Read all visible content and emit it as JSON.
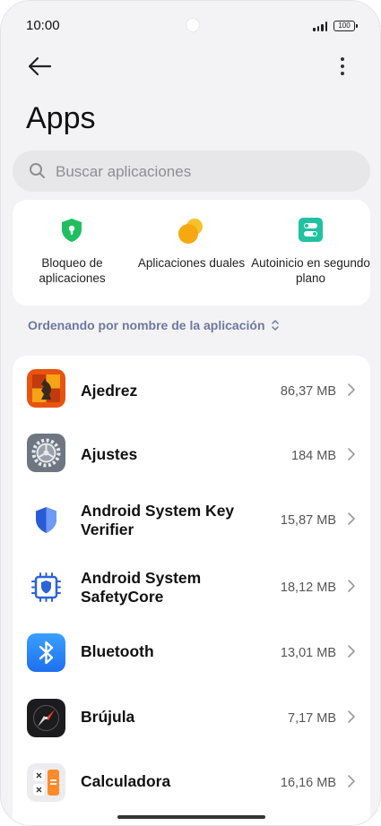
{
  "status_bar": {
    "time": "10:00",
    "battery": "100"
  },
  "header": {
    "title": "Apps"
  },
  "search": {
    "placeholder": "Buscar aplicaciones"
  },
  "features": [
    {
      "label": "Bloqueo de aplicaciones",
      "icon": "shield-lock-icon",
      "color": "#1fbf5f"
    },
    {
      "label": "Aplicaciones duales",
      "icon": "dual-apps-icon",
      "color": "#f5b00f"
    },
    {
      "label": "Autoinicio en segundo plano",
      "icon": "autostart-icon",
      "color": "#20c2a0"
    }
  ],
  "sort": {
    "label": "Ordenando por nombre de la aplicación"
  },
  "apps": [
    {
      "name": "Ajedrez",
      "size": "86,37 MB",
      "icon": "chess-icon"
    },
    {
      "name": "Ajustes",
      "size": "184 MB",
      "icon": "settings-gear-icon"
    },
    {
      "name": "Android System Key Verifier",
      "size": "15,87 MB",
      "icon": "shield-key-icon"
    },
    {
      "name": "Android System SafetyCore",
      "size": "18,12 MB",
      "icon": "chip-shield-icon"
    },
    {
      "name": "Bluetooth",
      "size": "13,01 MB",
      "icon": "bluetooth-icon"
    },
    {
      "name": "Brújula",
      "size": "7,17 MB",
      "icon": "compass-icon"
    },
    {
      "name": "Calculadora",
      "size": "16,16 MB",
      "icon": "calculator-icon"
    }
  ],
  "colors": {
    "background": "#f3f3f5",
    "card": "#ffffff",
    "sort_text": "#6e78a0"
  }
}
